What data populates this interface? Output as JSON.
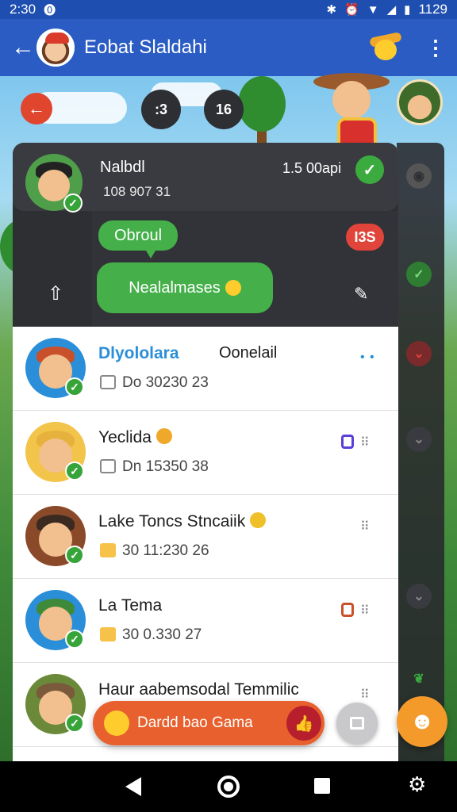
{
  "status_bar": {
    "time": "2:30",
    "left_icon": "circle-o-icon",
    "right_text": "1129"
  },
  "header": {
    "title": "Eobat Slaldahi"
  },
  "scene": {
    "counter_a": ":3",
    "counter_b": "16"
  },
  "pinned": {
    "name": "Nalbdl",
    "subtitle": "108 907 31",
    "time": "1.5 00api"
  },
  "preview": {
    "bubble_small": "Obroul",
    "bubble_large": "Nealalmases",
    "red_chip": "I3S"
  },
  "chats": [
    {
      "name": "Dlyololara",
      "aside": "Oonelail",
      "sub": "Do 30230 23",
      "sub_icon": "share",
      "avatar_hair": "#c8502a"
    },
    {
      "name": "Yeclida",
      "aside": "",
      "sub": "Dn 15350 38",
      "sub_icon": "share",
      "avatar_hair": "#e7b13d"
    },
    {
      "name": "Lake Toncs Stncaiik",
      "aside": "",
      "sub": "30 11:230 26",
      "sub_icon": "calendar",
      "avatar_hair": "#3a2a1f"
    },
    {
      "name": "La Tema",
      "aside": "",
      "sub": "30 0.330 27",
      "sub_icon": "calendar",
      "avatar_hair": "#3f8a3a"
    },
    {
      "name": "Haur aabemsodal Temmilic",
      "aside": "",
      "sub": "",
      "sub_icon": "",
      "avatar_hair": "#7a5a3a"
    }
  ],
  "fab": {
    "game_label": "Dardd bao Gama"
  },
  "colors": {
    "app_bar": "#2a5cc4",
    "accent_green": "#45b04a",
    "accent_orange": "#e8602d"
  }
}
